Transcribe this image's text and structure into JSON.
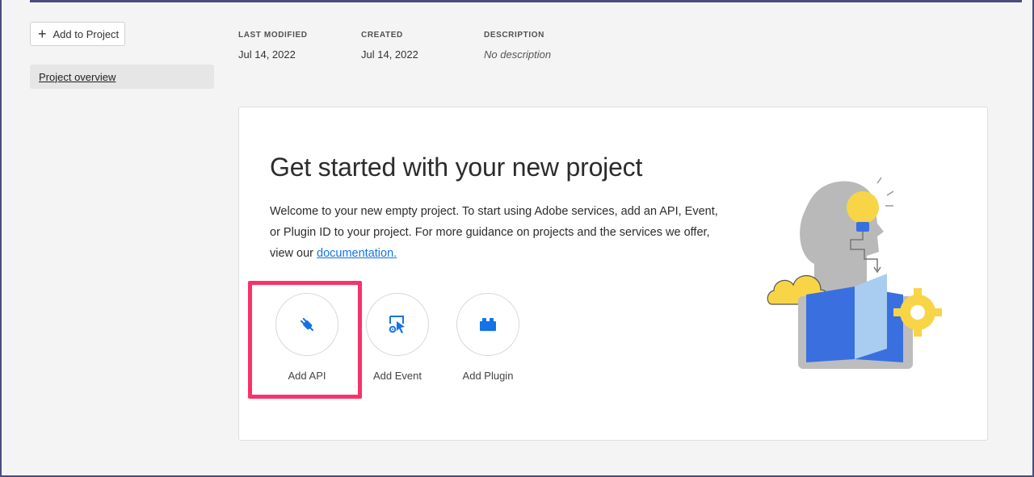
{
  "sidebar": {
    "add_project_label": "Add to Project",
    "nav_items": [
      {
        "label": "Project overview",
        "selected": true
      }
    ]
  },
  "meta": {
    "last_modified_label": "LAST MODIFIED",
    "last_modified_value": "Jul 14, 2022",
    "created_label": "CREATED",
    "created_value": "Jul 14, 2022",
    "description_label": "DESCRIPTION",
    "description_value": "No description"
  },
  "card": {
    "title": "Get started with your new project",
    "description": "Welcome to your new empty project. To start using Adobe services, add an API, Event, or Plugin ID to your project. For more guidance on projects and the services we offer, view our",
    "link_text": "documentation.",
    "actions": [
      {
        "label": "Add API",
        "icon": "plug-icon",
        "highlighted": true
      },
      {
        "label": "Add Event",
        "icon": "event-icon"
      },
      {
        "label": "Add Plugin",
        "icon": "plugin-icon"
      }
    ]
  },
  "colors": {
    "accent_blue": "#1473e6",
    "highlight_pink": "#f8336a",
    "frame": "#4b4c84"
  }
}
